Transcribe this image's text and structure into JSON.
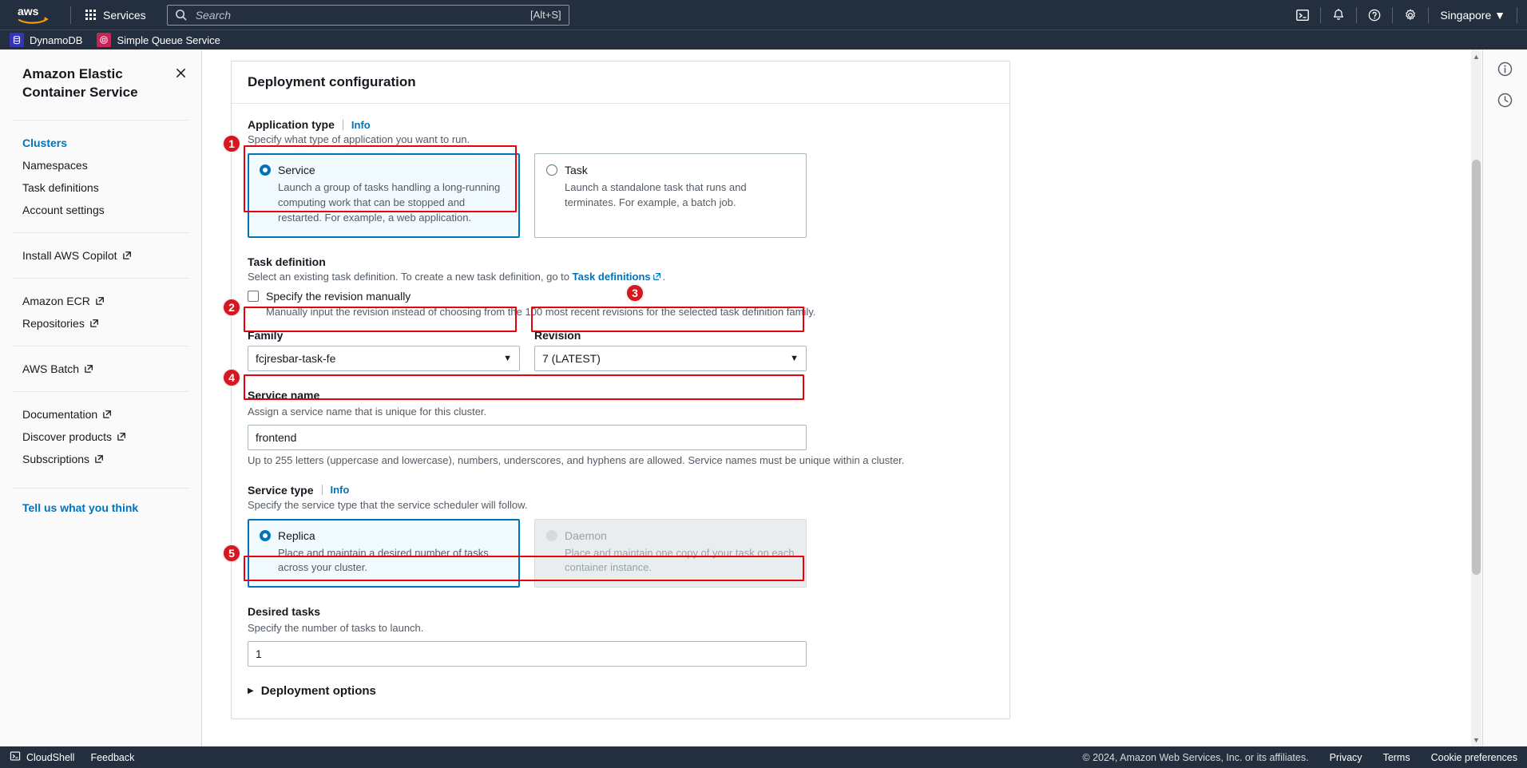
{
  "topnav": {
    "logo_alt": "aws",
    "services_label": "Services",
    "search_placeholder": "Search",
    "search_value": "",
    "search_shortcut": "[Alt+S]",
    "region_label": "Singapore",
    "region_caret": "▼",
    "icons": [
      "cloudshell-icon",
      "notifications-bell-icon",
      "help-circle-icon",
      "settings-gear-icon"
    ]
  },
  "servicebar": {
    "items": [
      {
        "label": "DynamoDB",
        "badge": "dynamodb-icon"
      },
      {
        "label": "Simple Queue Service",
        "badge": "sqs-icon"
      }
    ]
  },
  "sidebar": {
    "title": "Amazon Elastic Container Service",
    "close_label": "✕",
    "groups": [
      {
        "items": [
          {
            "label": "Clusters",
            "active": true,
            "external": false
          },
          {
            "label": "Namespaces",
            "active": false,
            "external": false
          },
          {
            "label": "Task definitions",
            "active": false,
            "external": false
          },
          {
            "label": "Account settings",
            "active": false,
            "external": false
          }
        ]
      },
      {
        "items": [
          {
            "label": "Install AWS Copilot",
            "active": false,
            "external": true
          }
        ]
      },
      {
        "items": [
          {
            "label": "Amazon ECR",
            "active": false,
            "external": true
          },
          {
            "label": "Repositories",
            "active": false,
            "external": true
          }
        ]
      },
      {
        "items": [
          {
            "label": "AWS Batch",
            "active": false,
            "external": true
          }
        ]
      },
      {
        "items": [
          {
            "label": "Documentation",
            "active": false,
            "external": true
          },
          {
            "label": "Discover products",
            "active": false,
            "external": true
          },
          {
            "label": "Subscriptions",
            "active": false,
            "external": true
          }
        ]
      }
    ],
    "feedback_label": "Tell us what you think"
  },
  "main": {
    "card_title": "Deployment configuration",
    "application_type": {
      "label": "Application type",
      "info_label": "Info",
      "description": "Specify what type of application you want to run.",
      "options": [
        {
          "title": "Service",
          "description": "Launch a group of tasks handling a long-running computing work that can be stopped and restarted. For example, a web application.",
          "selected": true,
          "disabled": false
        },
        {
          "title": "Task",
          "description": "Launch a standalone task that runs and terminates. For example, a batch job.",
          "selected": false,
          "disabled": false
        }
      ]
    },
    "task_definition": {
      "label": "Task definition",
      "description_pre": "Select an existing task definition. To create a new task definition, go to ",
      "description_link": "Task definitions",
      "description_post": ".",
      "checkbox_label": "Specify the revision manually",
      "checkbox_checked": false,
      "checkbox_hint": "Manually input the revision instead of choosing from the 100 most recent revisions for the selected task definition family.",
      "family_label": "Family",
      "family_value": "fcjresbar-task-fe",
      "revision_label": "Revision",
      "revision_value": "7 (LATEST)"
    },
    "service_name": {
      "label": "Service name",
      "description": "Assign a service name that is unique for this cluster.",
      "value": "frontend",
      "placeholder": "",
      "hint": "Up to 255 letters (uppercase and lowercase), numbers, underscores, and hyphens are allowed. Service names must be unique within a cluster."
    },
    "service_type": {
      "label": "Service type",
      "info_label": "Info",
      "description": "Specify the service type that the service scheduler will follow.",
      "options": [
        {
          "title": "Replica",
          "description": "Place and maintain a desired number of tasks across your cluster.",
          "selected": true,
          "disabled": false
        },
        {
          "title": "Daemon",
          "description": "Place and maintain one copy of your task on each container instance.",
          "selected": false,
          "disabled": true
        }
      ]
    },
    "desired_tasks": {
      "label": "Desired tasks",
      "description": "Specify the number of tasks to launch.",
      "value": "1",
      "placeholder": ""
    },
    "deployment_options": {
      "label": "Deployment options",
      "expanded": false,
      "triangle": "▶"
    }
  },
  "annotations": [
    {
      "number": "1",
      "target": "application-type-service-tile"
    },
    {
      "number": "2",
      "target": "family-select"
    },
    {
      "number": "3",
      "target": "revision-select"
    },
    {
      "number": "4",
      "target": "service-name-input"
    },
    {
      "number": "5",
      "target": "desired-tasks-input"
    }
  ],
  "right_rail": {
    "icons": [
      "info-circle-icon",
      "history-clock-icon"
    ]
  },
  "footer": {
    "cloudshell_label": "CloudShell",
    "feedback_label": "Feedback",
    "copyright": "© 2024, Amazon Web Services, Inc. or its affiliates.",
    "links": [
      "Privacy",
      "Terms",
      "Cookie preferences"
    ]
  },
  "colors": {
    "nav_bg": "#232f3e",
    "accent_blue": "#0073bb",
    "highlight_red": "#e8000d",
    "badge_red": "#d81620",
    "selected_tile_bg": "#f1faff"
  }
}
